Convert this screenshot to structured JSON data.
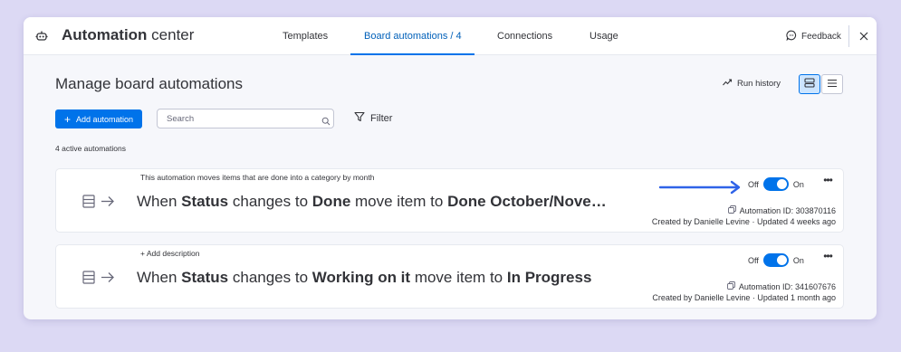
{
  "app": {
    "title_bold": "Automation",
    "title_light": "center"
  },
  "tabs": [
    {
      "label": "Templates",
      "active": false
    },
    {
      "label": "Board automations / 4",
      "active": true
    },
    {
      "label": "Connections",
      "active": false
    },
    {
      "label": "Usage",
      "active": false
    }
  ],
  "header_actions": {
    "feedback_label": "Feedback"
  },
  "page": {
    "title": "Manage board automations",
    "run_history_label": "Run history"
  },
  "toolbar": {
    "add_label": "Add automation",
    "search_placeholder": "Search",
    "filter_label": "Filter"
  },
  "summary": {
    "count_text": "4 active automations"
  },
  "automations": [
    {
      "description": "This automation moves items that are done into a category by month",
      "parts": [
        "When",
        "Status",
        "changes to",
        "Done",
        "move item to",
        "Done October/Nove…"
      ],
      "off_label": "Off",
      "on_label": "On",
      "enabled": true,
      "id_text": "Automation ID: 303870116",
      "created_text": "Created by Danielle Levine · Updated 4 weeks ago"
    },
    {
      "description": "+ Add description",
      "parts": [
        "When",
        "Status",
        "changes to",
        "Working on it",
        "move item to",
        "In Progress"
      ],
      "off_label": "Off",
      "on_label": "On",
      "enabled": true,
      "id_text": "Automation ID: 341607676",
      "created_text": "Created by Danielle Levine · Updated 1 month ago"
    }
  ],
  "colors": {
    "accent": "#0073ea",
    "annotation_arrow": "#2f63e8",
    "background": "#dcd9f4"
  },
  "icons": {
    "app": "robot-icon",
    "feedback": "chat-bubble-icon",
    "close": "close-icon",
    "run_history": "trend-line-icon",
    "card_view": "card-view-icon",
    "list_view": "list-view-icon",
    "search": "search-icon",
    "filter": "filter-funnel-icon",
    "card_glyph": "list-arrow-icon",
    "copy": "copy-icon",
    "more": "more-dots-icon"
  }
}
